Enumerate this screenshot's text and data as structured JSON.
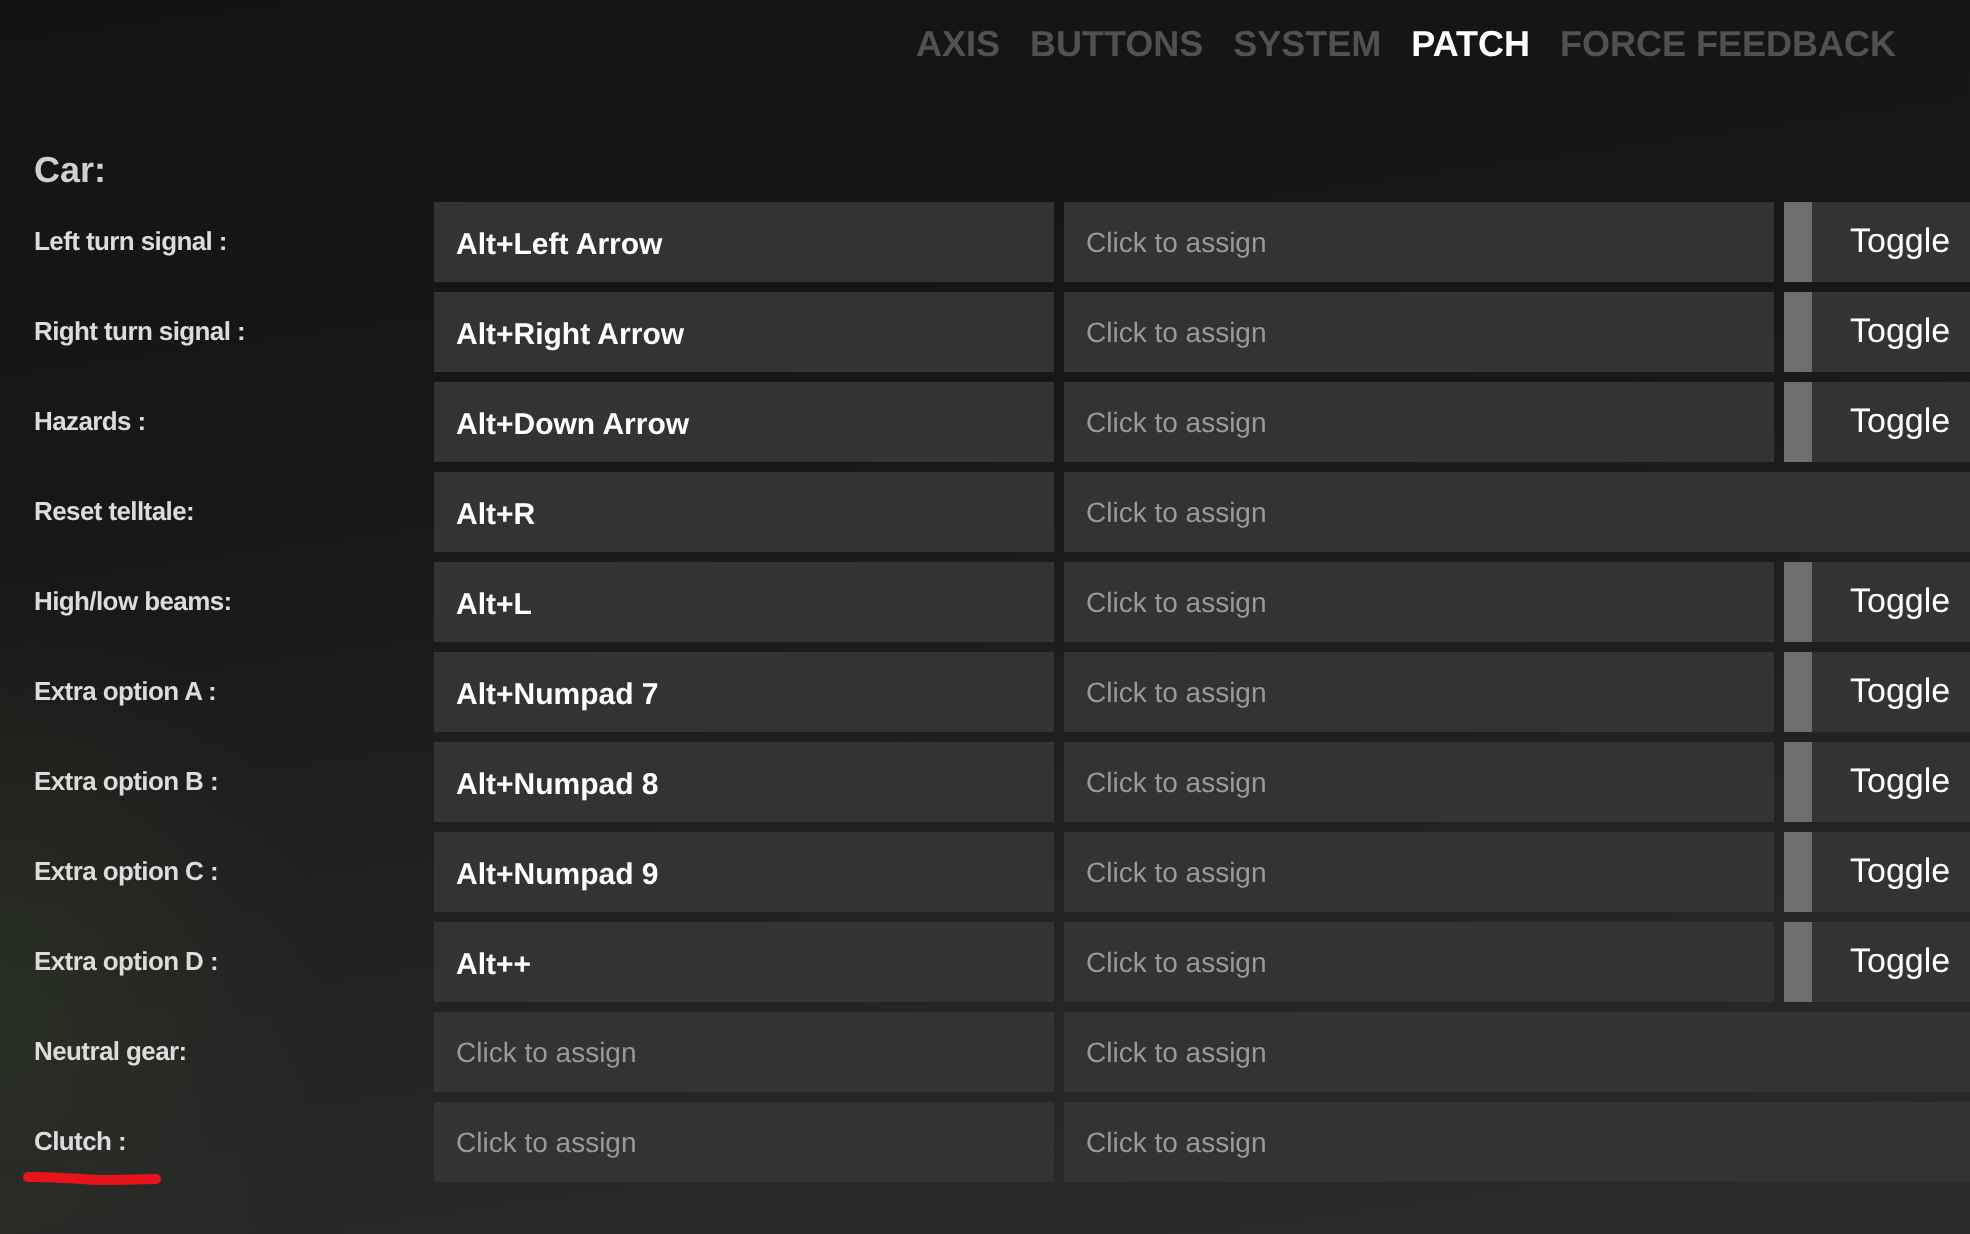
{
  "tabs": [
    {
      "label": "AXIS",
      "selected": false
    },
    {
      "label": "BUTTONS",
      "selected": false
    },
    {
      "label": "SYSTEM",
      "selected": false
    },
    {
      "label": "PATCH",
      "selected": true
    },
    {
      "label": "FORCE FEEDBACK",
      "selected": false
    }
  ],
  "section": {
    "title": "Car:"
  },
  "rows": [
    {
      "label": "Left turn signal :",
      "marked": false,
      "primary": {
        "value": "Alt+Left Arrow"
      },
      "secondary": {
        "placeholder": "Click to assign"
      },
      "toggle": {
        "label": "Toggle",
        "on": false
      }
    },
    {
      "label": "Right turn signal :",
      "marked": false,
      "primary": {
        "value": "Alt+Right Arrow"
      },
      "secondary": {
        "placeholder": "Click to assign"
      },
      "toggle": {
        "label": "Toggle",
        "on": false
      }
    },
    {
      "label": "Hazards :",
      "marked": false,
      "primary": {
        "value": "Alt+Down Arrow"
      },
      "secondary": {
        "placeholder": "Click to assign"
      },
      "toggle": {
        "label": "Toggle",
        "on": false
      }
    },
    {
      "label": "Reset telltale:",
      "marked": false,
      "primary": {
        "value": "Alt+R"
      },
      "secondary": {
        "placeholder": "Click to assign"
      }
    },
    {
      "label": "High/low beams:",
      "marked": false,
      "primary": {
        "value": "Alt+L"
      },
      "secondary": {
        "placeholder": "Click to assign"
      },
      "toggle": {
        "label": "Toggle",
        "on": false
      }
    },
    {
      "label": "Extra option A :",
      "marked": false,
      "primary": {
        "value": "Alt+Numpad 7"
      },
      "secondary": {
        "placeholder": "Click to assign"
      },
      "toggle": {
        "label": "Toggle",
        "on": false
      }
    },
    {
      "label": "Extra option B :",
      "marked": false,
      "primary": {
        "value": "Alt+Numpad 8"
      },
      "secondary": {
        "placeholder": "Click to assign"
      },
      "toggle": {
        "label": "Toggle",
        "on": false
      }
    },
    {
      "label": "Extra option C :",
      "marked": false,
      "primary": {
        "value": "Alt+Numpad 9"
      },
      "secondary": {
        "placeholder": "Click to assign"
      },
      "toggle": {
        "label": "Toggle",
        "on": false
      }
    },
    {
      "label": "Extra option D :",
      "marked": false,
      "primary": {
        "value": "Alt++"
      },
      "secondary": {
        "placeholder": "Click to assign"
      },
      "toggle": {
        "label": "Toggle",
        "on": false
      }
    },
    {
      "label": "Neutral gear:",
      "marked": false,
      "primary": {
        "placeholder": "Click to assign"
      },
      "secondary": {
        "placeholder": "Click to assign"
      }
    },
    {
      "label": "Clutch :",
      "marked": true,
      "primary": {
        "placeholder": "Click to assign"
      },
      "secondary": {
        "placeholder": "Click to assign"
      }
    }
  ]
}
